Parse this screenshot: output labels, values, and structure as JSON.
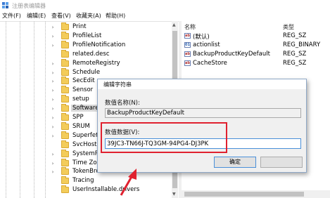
{
  "window": {
    "title": "注册表编辑器"
  },
  "menu": [
    "文件(F)",
    "编辑(E)",
    "查看(V)",
    "收藏夹(A)",
    "帮助(H)"
  ],
  "tree": {
    "items": [
      {
        "label": "Print",
        "expandable": true
      },
      {
        "label": "ProfileList",
        "expandable": true
      },
      {
        "label": "ProfileNotification",
        "expandable": true
      },
      {
        "label": "related.desc",
        "expandable": false
      },
      {
        "label": "RemoteRegistry",
        "expandable": true
      },
      {
        "label": "Schedule",
        "expandable": true
      },
      {
        "label": "SecEdit",
        "expandable": true
      },
      {
        "label": "Sensor",
        "expandable": true
      },
      {
        "label": "setup",
        "expandable": true
      },
      {
        "label": "SoftwareP",
        "expandable": true,
        "selected": true
      },
      {
        "label": "SPP",
        "expandable": true
      },
      {
        "label": "SRUM",
        "expandable": true
      },
      {
        "label": "Superfetc",
        "expandable": true
      },
      {
        "label": "SvcHost",
        "expandable": false
      },
      {
        "label": "SystemRe",
        "expandable": true
      },
      {
        "label": "Time Zon",
        "expandable": true
      },
      {
        "label": "TokenBroker",
        "expandable": true
      },
      {
        "label": "Tracing",
        "expandable": false
      },
      {
        "label": "UserInstallable.drivers",
        "expandable": false
      }
    ]
  },
  "values": {
    "columns": {
      "name": "名称",
      "type": "类型"
    },
    "rows": [
      {
        "name": "(默认)",
        "type": "REG_SZ",
        "icon": "ab"
      },
      {
        "name": "actionlist",
        "type": "REG_BINARY",
        "icon": "bin"
      },
      {
        "name": "BackupProductKeyDefault",
        "type": "REG_SZ",
        "icon": "ab"
      },
      {
        "name": "CacheStore",
        "type": "REG_SZ",
        "icon": "ab"
      }
    ]
  },
  "dialog": {
    "title": "编辑字符串",
    "name_label": "数值名称(N):",
    "name_value": "BackupProductKeyDefault",
    "data_label": "数值数据(V):",
    "data_value": "39JC3-TN66J-TQ3GM-94PG4-DJ3PK",
    "ok_label": "确定",
    "cancel_label": ""
  },
  "colors": {
    "annotation": "#e0212f",
    "folder": "#f3cc5a",
    "focus_border": "#4a90d9"
  }
}
